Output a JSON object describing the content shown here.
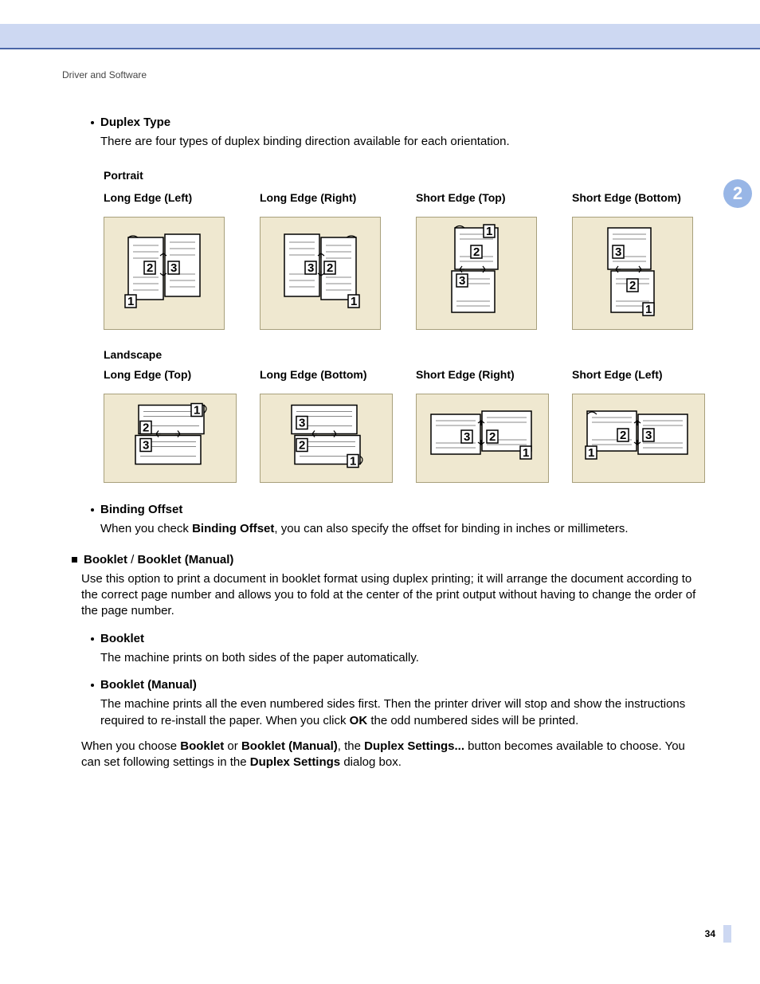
{
  "running_header": "Driver and Software",
  "section_number": "2",
  "page_number": "34",
  "duplex_type": {
    "title": "Duplex Type",
    "desc": "There are four types of duplex binding direction available for each orientation.",
    "portrait": {
      "label": "Portrait",
      "cols": [
        "Long Edge (Left)",
        "Long Edge (Right)",
        "Short Edge (Top)",
        "Short Edge (Bottom)"
      ]
    },
    "landscape": {
      "label": "Landscape",
      "cols": [
        "Long Edge (Top)",
        "Long Edge (Bottom)",
        "Short Edge (Right)",
        "Short Edge (Left)"
      ]
    }
  },
  "binding_offset": {
    "title": "Binding Offset",
    "pre": "When you check ",
    "bold": "Binding Offset",
    "post": ", you can also specify the offset for binding in inches or millimeters."
  },
  "booklet_section": {
    "title1": "Booklet",
    "slash": " / ",
    "title2": "Booklet (Manual)",
    "desc": "Use this option to print a document in booklet format using duplex printing; it will arrange the document according to the correct page number and allows you to fold at the center of the print output without having to change the order of the page number.",
    "booklet": {
      "title": "Booklet",
      "desc": "The machine prints on both sides of the paper automatically."
    },
    "booklet_manual": {
      "title": "Booklet (Manual)",
      "desc_pre": "The machine prints all the even numbered sides first. Then the printer driver will stop and show the instructions required to re-install the paper. When you click ",
      "desc_bold": "OK",
      "desc_post": " the odd numbered sides will be printed."
    },
    "closing": {
      "p1": "When you choose ",
      "b1": "Booklet",
      "p2": " or ",
      "b2": "Booklet (Manual)",
      "p3": ", the ",
      "b3": "Duplex Settings...",
      "p4": " button becomes available to choose. You can set following settings in the ",
      "b4": "Duplex Settings",
      "p5": " dialog box."
    }
  }
}
